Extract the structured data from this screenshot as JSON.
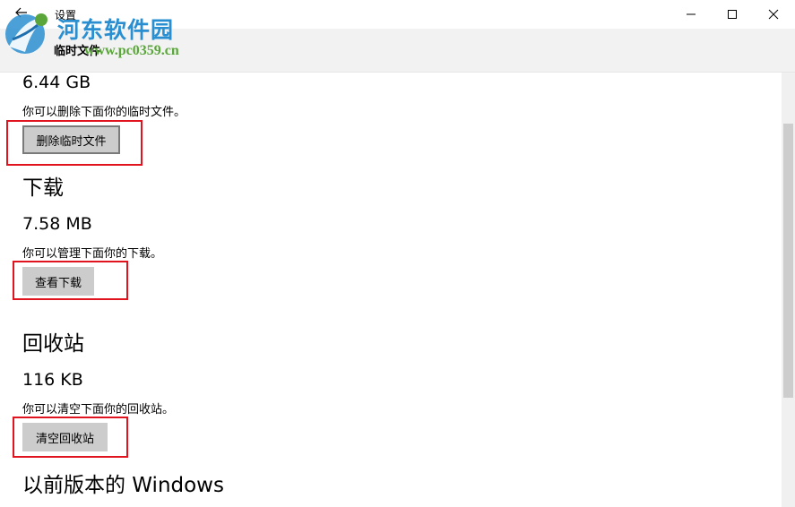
{
  "window": {
    "app_title": "设置",
    "back_icon": "back-arrow-icon",
    "minimize_icon": "minimize-icon",
    "maximize_icon": "maximize-icon",
    "close_icon": "close-icon"
  },
  "header": {
    "title": "临时文件"
  },
  "watermark": {
    "line1": "河东软件园",
    "line2": "www.pc0359.cn",
    "colors": {
      "primary": "#2a8fd0",
      "secondary": "#5aa63a"
    }
  },
  "sections": {
    "temp": {
      "size": "6.44 GB",
      "description": "你可以删除下面你的临时文件。",
      "button_label": "删除临时文件"
    },
    "downloads": {
      "title": "下载",
      "size": "7.58 MB",
      "description": "你可以管理下面你的下载。",
      "button_label": "查看下载"
    },
    "recycle": {
      "title": "回收站",
      "size": "116 KB",
      "description": "你可以清空下面你的回收站。",
      "button_label": "清空回收站"
    },
    "previous": {
      "title": "以前版本的 Windows"
    }
  },
  "colors": {
    "highlight_box": "#e0141e",
    "button_bg": "#cccccc",
    "header_bg": "#f2f2f2"
  }
}
